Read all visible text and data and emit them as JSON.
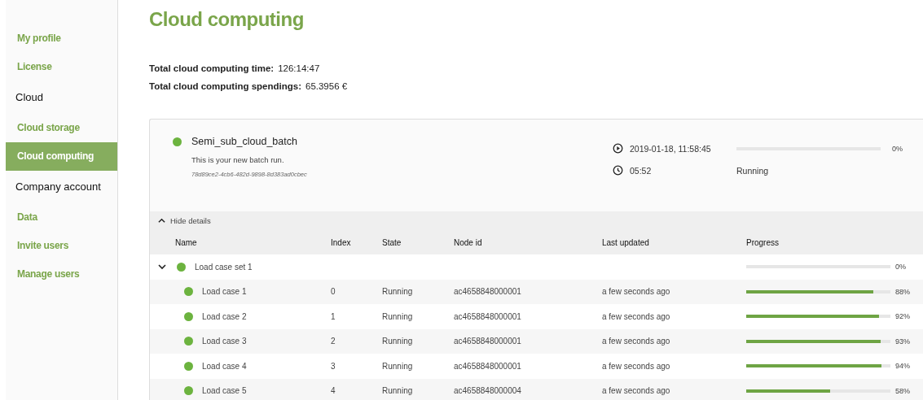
{
  "sidebar": {
    "sections": [
      {
        "items": [
          {
            "label": "My profile",
            "selected": false
          },
          {
            "label": "License",
            "selected": false
          }
        ]
      },
      {
        "heading": "Cloud",
        "items": [
          {
            "label": "Cloud storage",
            "selected": false
          },
          {
            "label": "Cloud computing",
            "selected": true
          }
        ]
      },
      {
        "heading": "Company account",
        "items": [
          {
            "label": "Data",
            "selected": false
          },
          {
            "label": "Invite users",
            "selected": false
          },
          {
            "label": "Manage users",
            "selected": false
          }
        ]
      }
    ]
  },
  "page_title": "Cloud computing",
  "totals": [
    {
      "label": "Total cloud computing time:",
      "value": "126:14:47"
    },
    {
      "label": "Total cloud computing spendings:",
      "value": "65.3956 €"
    }
  ],
  "batch": {
    "name": "Semi_sub_cloud_batch",
    "color": "#6cb33f",
    "description": "This is your new batch run.",
    "id": "78d89ce2-4cb6-482d-9898-8d383ad0cbec",
    "started": "2019-01-18, 11:58:45",
    "duration": "05:52",
    "level": 0,
    "percent": "0%",
    "state": "Running",
    "details_toggle": {
      "label": "Hide details",
      "expanded": true
    },
    "columns": [
      "Name",
      "Index",
      "State",
      "Node id",
      "Last updated",
      "Progress"
    ],
    "rows": [
      {
        "name": "Load case set 1",
        "color": "#6cb33f",
        "expanded": true,
        "level": 0,
        "percent": "0%",
        "children": [
          {
            "name": "Load case 1",
            "color": "#6cb33f",
            "index": "0",
            "state": "Running",
            "node_id": "ac4658848000001",
            "last_updated": "a few seconds ago",
            "level": 0.88,
            "percent": "88%"
          },
          {
            "name": "Load case 2",
            "color": "#6cb33f",
            "index": "1",
            "state": "Running",
            "node_id": "ac4658848000001",
            "last_updated": "a few seconds ago",
            "level": 0.92,
            "percent": "92%"
          },
          {
            "name": "Load case 3",
            "color": "#6cb33f",
            "index": "2",
            "state": "Running",
            "node_id": "ac4658848000001",
            "last_updated": "a few seconds ago",
            "level": 0.93,
            "percent": "93%"
          },
          {
            "name": "Load case 4",
            "color": "#6cb33f",
            "index": "3",
            "state": "Running",
            "node_id": "ac4658848000001",
            "last_updated": "a few seconds ago",
            "level": 0.94,
            "percent": "94%"
          },
          {
            "name": "Load case 5",
            "color": "#6cb33f",
            "index": "4",
            "state": "Running",
            "node_id": "ac4658848000004",
            "last_updated": "a few seconds ago",
            "level": 0.58,
            "percent": "58%"
          }
        ]
      }
    ]
  }
}
